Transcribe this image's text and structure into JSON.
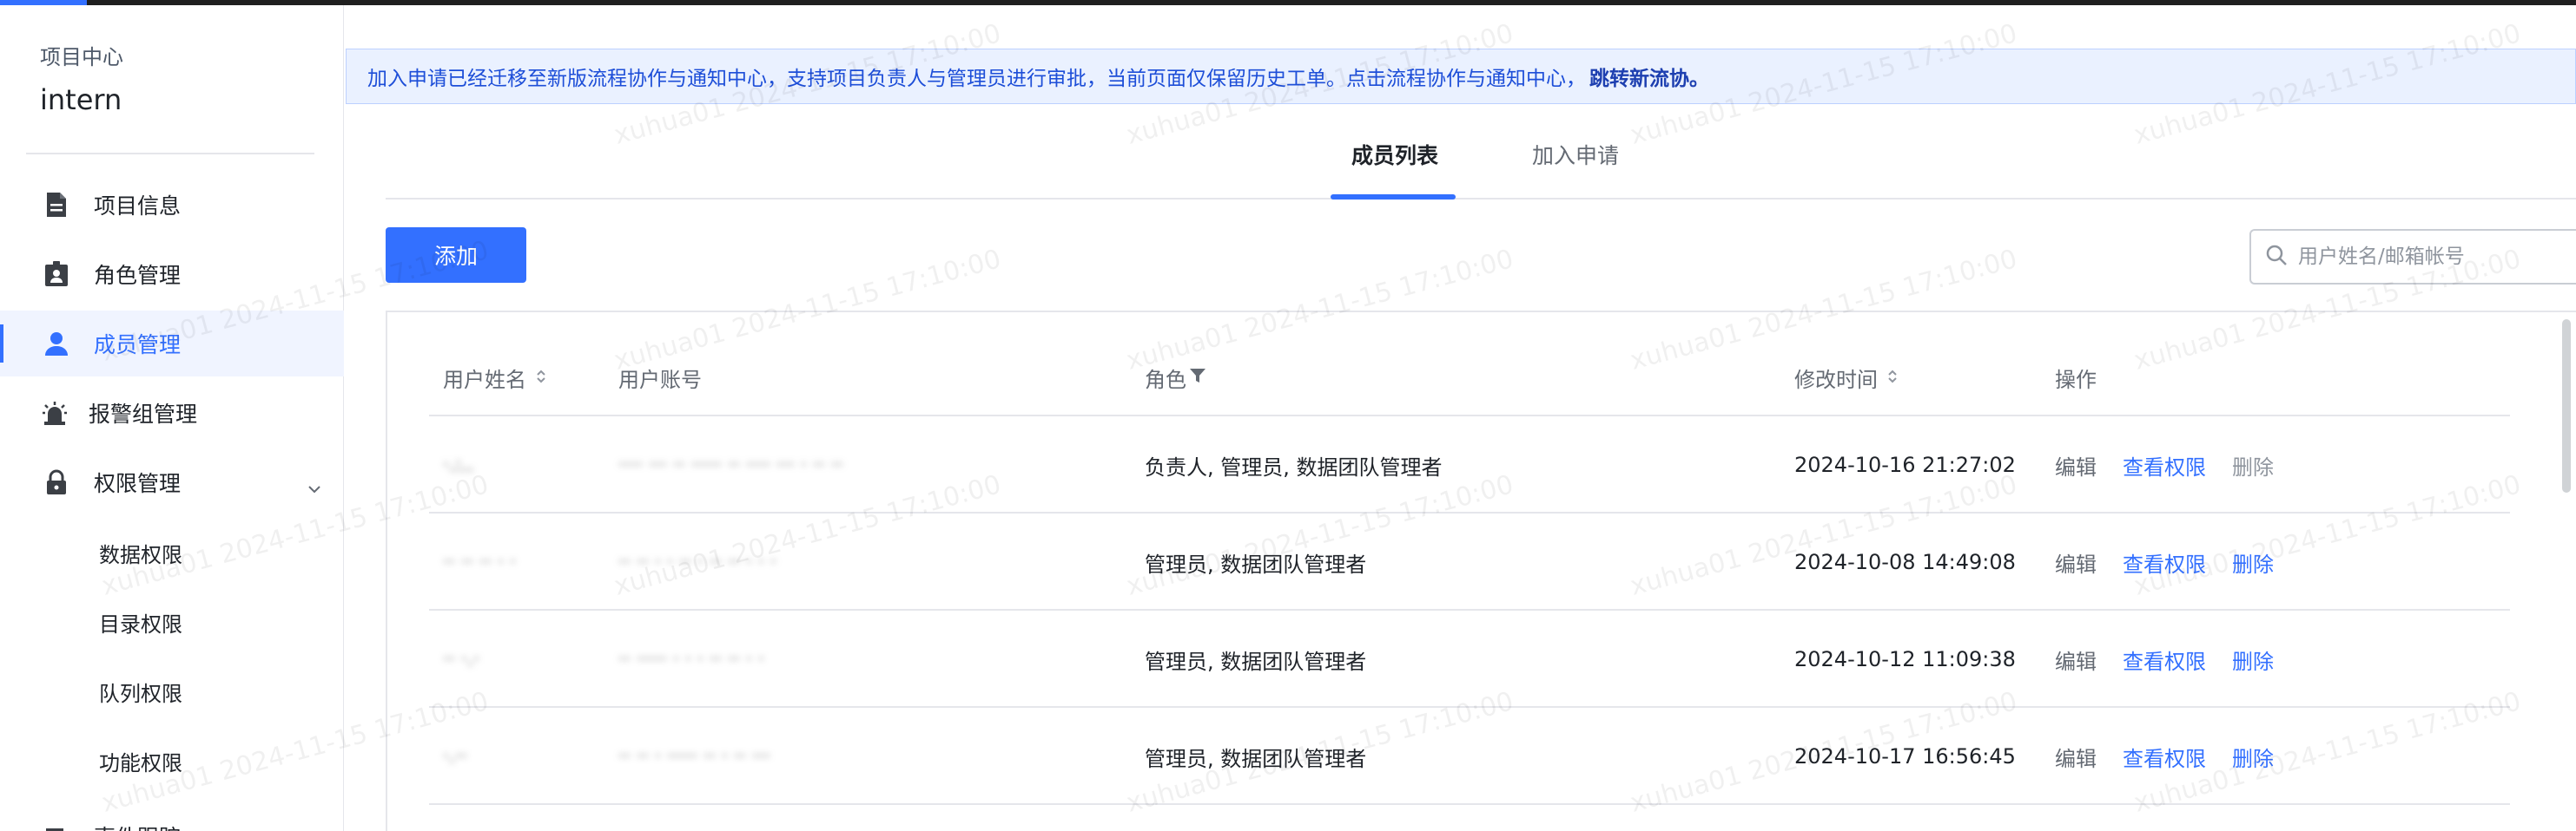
{
  "sidebar": {
    "project_label": "项目中心",
    "project_name": "intern",
    "items": [
      {
        "label": "项目信息",
        "icon": "document-icon"
      },
      {
        "label": "角色管理",
        "icon": "id-badge-icon"
      },
      {
        "label": "成员管理",
        "icon": "user-icon",
        "active": true
      },
      {
        "label": "报警组管理",
        "icon": "alarm-icon"
      },
      {
        "label": "权限管理",
        "icon": "lock-icon",
        "expanded": true
      }
    ],
    "sub_items": [
      "数据权限",
      "目录权限",
      "队列权限",
      "功能权限"
    ],
    "next_item": "事件跟踪"
  },
  "notice": {
    "text": "加入申请已经迁移至新版流程协作与通知中心，支持项目负责人与管理员进行审批，当前页面仅保留历史工单。点击流程协作与通知中心，",
    "link": "跳转新流协。"
  },
  "tabs": [
    {
      "label": "成员列表",
      "active": true
    },
    {
      "label": "加入申请",
      "active": false
    }
  ],
  "toolbar": {
    "add_label": "添加",
    "search_placeholder": "用户姓名/邮箱帐号"
  },
  "table": {
    "headers": {
      "name": "用户姓名",
      "account": "用户账号",
      "role": "角色",
      "modified": "修改时间",
      "actions": "操作"
    },
    "action_labels": {
      "edit": "编辑",
      "view": "查看权限",
      "delete": "删除"
    },
    "rows": [
      {
        "name": "·.:..",
        "account": "···· ··· ·· ·····  ·· ···· ··· ·  ·· ··",
        "role": "负责人, 管理员, 数据团队管理者",
        "modified": "2024-10-16 21:27:02"
      },
      {
        "name": "·· ·· ·· · ·",
        "account": "·· ·· · · ·· · ·· ·· · · ·",
        "role": "管理员, 数据团队管理者",
        "modified": "2024-10-08 14:49:08"
      },
      {
        "name": "·· ·.·",
        "account": "·· ·····  · · · ·· ·· · ·",
        "role": "管理员, 数据团队管理者",
        "modified": "2024-10-12 11:09:38"
      },
      {
        "name": "·.··",
        "account": "·· ·· ·  ····· ·· · ·· ···",
        "role": "管理员, 数据团队管理者",
        "modified": "2024-10-17 16:56:45"
      }
    ]
  },
  "watermark": "xuhua01 2024-11-15 17:10:00",
  "colors": {
    "accent": "#3370ff",
    "notice_bg": "#eaf1ff"
  }
}
